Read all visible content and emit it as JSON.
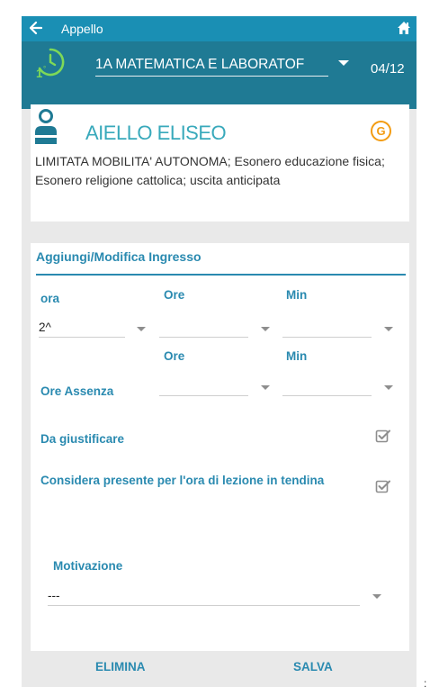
{
  "header": {
    "title": "Appello",
    "back_icon": "arrow-left-icon",
    "home_icon": "home-icon"
  },
  "class_bar": {
    "class_name": "1A MATEMATICA E LABORATOF",
    "counter": "04/12",
    "clock_icon": "clock-first-hour-icon"
  },
  "student": {
    "name": "AIELLO ELISEO",
    "badge": "G",
    "notes": "LIMITATA MOBILITA' AUTONOMA; Esonero educazione fisica; Esonero religione cattolica; uscita anticipata"
  },
  "form": {
    "title": "Aggiungi/Modifica Ingresso",
    "col_ora": "ora",
    "col_ore": "Ore",
    "col_min": "Min",
    "ora_value": "2^",
    "ore_value": "",
    "min_value": "",
    "row2_ore": "Ore",
    "row2_min": "Min",
    "ore_assenza_label": "Ore Assenza",
    "assenza_ore_value": "",
    "assenza_min_value": "",
    "da_giustificare_label": "Da giustificare",
    "da_giustificare_checked": true,
    "considera_label": "Considera presente per l'ora di lezione in tendina",
    "considera_checked": true,
    "motivazione_label": "Motivazione",
    "motivazione_value": "---"
  },
  "footer": {
    "delete_label": "ELIMINA",
    "save_label": "SALVA"
  },
  "colors": {
    "topbar": "#1a8fb4",
    "classbar": "#1f7a94",
    "accent": "#2a8ab0",
    "student_name": "#38a9bb",
    "badge": "#f39c12"
  },
  "stray_mark": ":"
}
